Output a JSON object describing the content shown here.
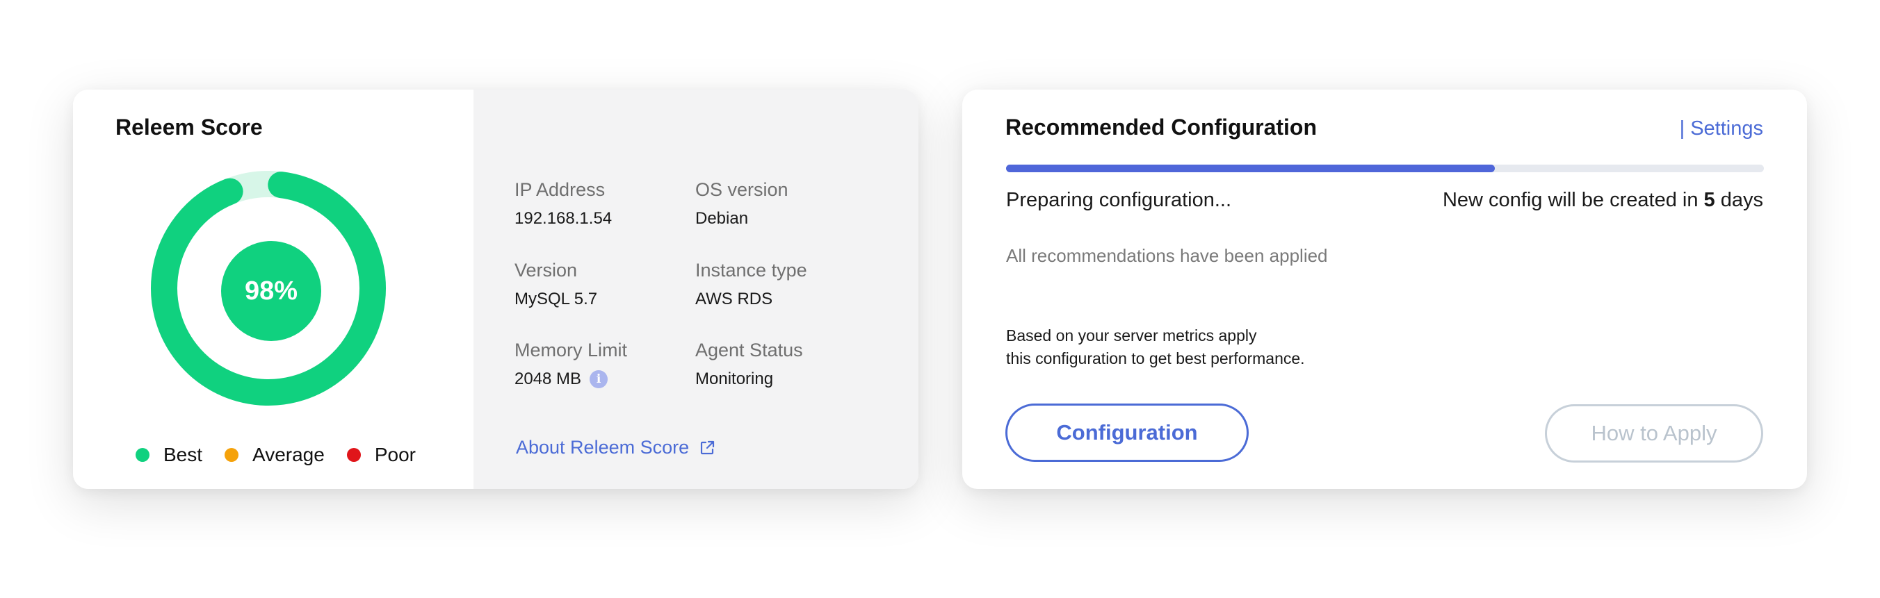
{
  "score_card": {
    "title": "Releem Score",
    "score": "98%",
    "score_value": 0.98,
    "colors": {
      "best": "#10d17f",
      "average": "#f5a20b",
      "poor": "#e0151a",
      "track": "#d7f6e8"
    },
    "legend": [
      {
        "label": "Best",
        "color": "#10d17f"
      },
      {
        "label": "Average",
        "color": "#f5a20b"
      },
      {
        "label": "Poor",
        "color": "#e0151a"
      }
    ],
    "info": {
      "ip_label": "IP Address",
      "ip_value": "192.168.1.54",
      "os_label": "OS version",
      "os_value": "Debian",
      "version_label": "Version",
      "version_value": "MySQL 5.7",
      "instance_label": "Instance type",
      "instance_value": "AWS RDS",
      "memory_label": "Memory Limit",
      "memory_value": "2048 MB",
      "agent_label": "Agent Status",
      "agent_value": "Monitoring"
    },
    "about_link": "About Releem Score"
  },
  "config_card": {
    "title": "Recommended Configuration",
    "settings_link": "| Settings",
    "progress": 0.645,
    "status": "Preparing configuration...",
    "next_prefix": "New config will be created in",
    "next_days": "5",
    "next_suffix": "days",
    "applied_note": "All recommendations have been  applied",
    "desc_line1": "Based on your server metrics apply",
    "desc_line2": "this configuration to get best performance.",
    "config_button": "Configuration",
    "how_button": "How to Apply"
  }
}
